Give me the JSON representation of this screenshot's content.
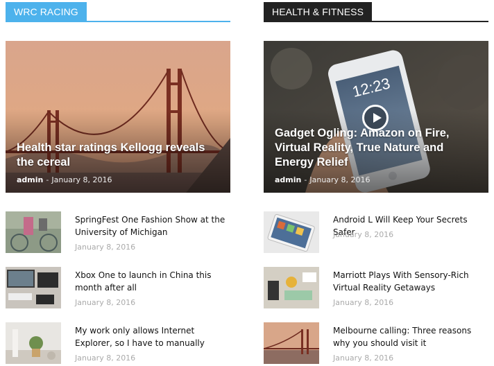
{
  "left_block": {
    "heading": "WRC RACING",
    "accent": "#4db2ec",
    "feature": {
      "title": "Health star ratings Kellogg reveals the cereal",
      "author": "admin",
      "separator": "-",
      "date": "January 8, 2016"
    },
    "items": [
      {
        "title": "SpringFest One Fashion Show at the University of Michigan",
        "date": "January 8, 2016"
      },
      {
        "title": "Xbox One to launch in China this month after all",
        "date": "January 8, 2016"
      },
      {
        "title": "My work only allows Internet Explorer, so I have to manually",
        "date": "January 8, 2016"
      }
    ]
  },
  "right_block": {
    "heading": "HEALTH & FITNESS",
    "accent": "#222222",
    "feature": {
      "title": "Gadget Ogling: Amazon on Fire, Virtual Reality, True Nature and Energy Relief",
      "author": "admin",
      "separator": "-",
      "date": "January 8, 2016",
      "phone_time": "12:23"
    },
    "items": [
      {
        "title": "Android L Will Keep Your Secrets Safer",
        "date": "January 8, 2016"
      },
      {
        "title": "Marriott Plays With Sensory-Rich Virtual Reality Getaways",
        "date": "January 8, 2016"
      },
      {
        "title": "Melbourne calling: Three reasons why you should visit it",
        "date": "January 8, 2016"
      }
    ]
  }
}
